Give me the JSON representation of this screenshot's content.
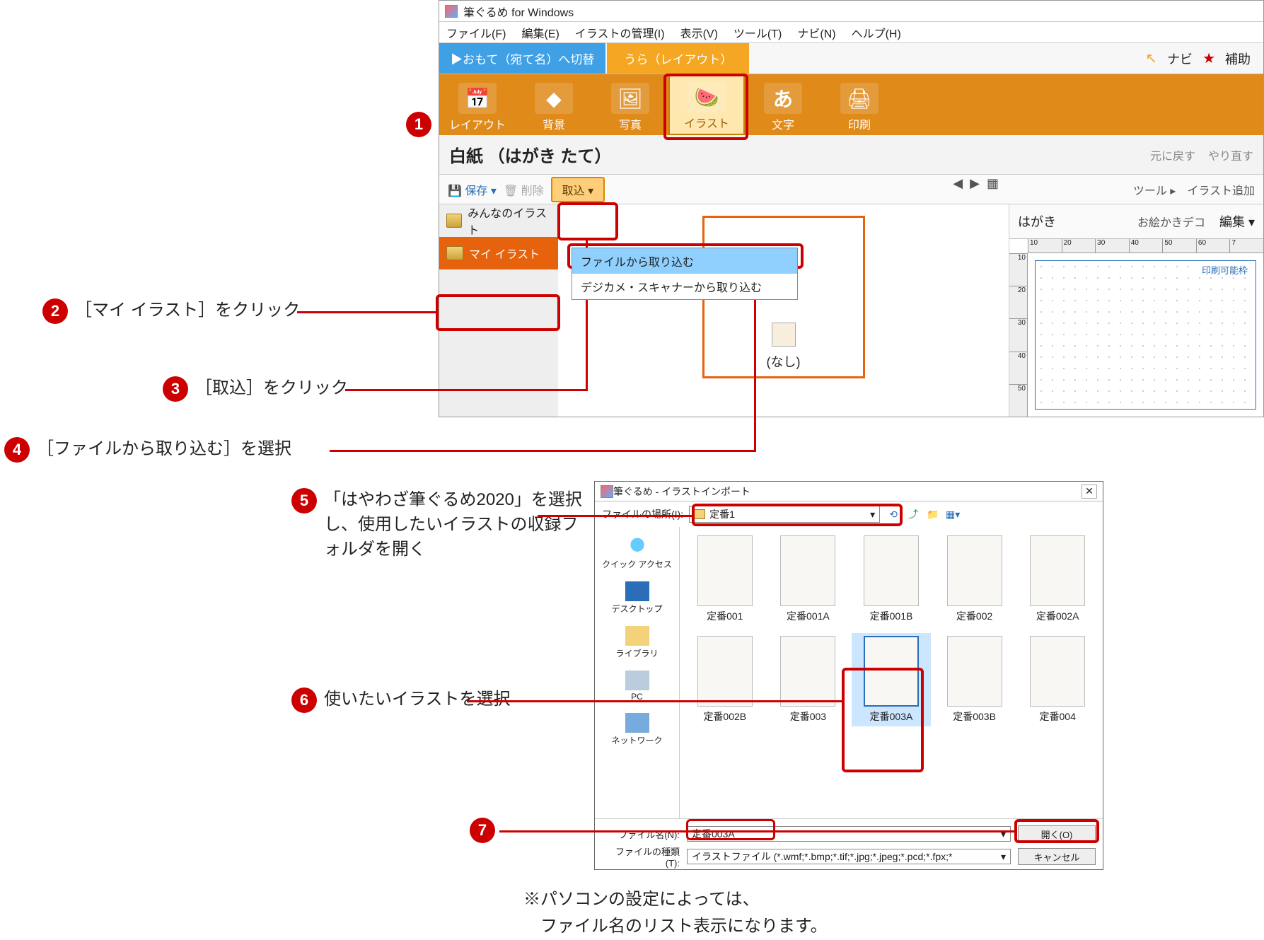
{
  "app": {
    "title": "筆ぐるめ for Windows",
    "menus": [
      "ファイル(F)",
      "編集(E)",
      "イラストの管理(I)",
      "表示(V)",
      "ツール(T)",
      "ナビ(N)",
      "ヘルプ(H)"
    ],
    "tab_blue": "▶おもて（宛て名）へ切替",
    "tab_orange": "うら（レイアウト）",
    "navi": "ナビ",
    "hojo": "補助",
    "ribbon": [
      {
        "label": "レイアウト"
      },
      {
        "label": "背景"
      },
      {
        "label": "写真"
      },
      {
        "label": "イラスト",
        "active": true
      },
      {
        "label": "文字"
      },
      {
        "label": "印刷"
      }
    ],
    "doc_title": "白紙 （はがき たて）",
    "undo": "元に戻す",
    "redo": "やり直す",
    "save": "保存",
    "delete": "削除",
    "import": "取込",
    "tool": "ツール",
    "add_illust": "イラスト追加",
    "side_items": [
      {
        "label": "みんなのイラスト"
      },
      {
        "label": "マイ イラスト",
        "selected": true
      }
    ],
    "dropdown": {
      "file": "ファイルから取り込む",
      "scanner": "デジカメ・スキャナーから取り込む"
    },
    "thumb_none": "(なし)",
    "hagaki": "はがき",
    "oekaki": "お絵かきデコ",
    "edit": "編集",
    "print_frame": "印刷可能枠",
    "ruler_ticks": [
      "10",
      "20",
      "30",
      "40",
      "50",
      "60",
      "7"
    ],
    "ruler_ticks_v": [
      "10",
      "20",
      "30",
      "40",
      "50"
    ]
  },
  "dialog": {
    "title": "筆ぐるめ - イラストインポート",
    "location_label": "ファイルの場所(I):",
    "location_value": "定番1",
    "places": [
      "クイック アクセス",
      "デスクトップ",
      "ライブラリ",
      "PC",
      "ネットワーク"
    ],
    "files_row1": [
      "定番001",
      "定番001A",
      "定番001B",
      "定番002",
      "定番002A"
    ],
    "files_row2": [
      "定番002B",
      "定番003",
      "定番003A",
      "定番003B",
      "定番004"
    ],
    "selected_file": "定番003A",
    "filename_label": "ファイル名(N):",
    "filename_value": "定番003A",
    "filetype_label": "ファイルの種類(T):",
    "filetype_value": "イラストファイル (*.wmf;*.bmp;*.tif;*.jpg;*.jpeg;*.pcd;*.fpx;*",
    "open": "開く(O)",
    "cancel": "キャンセル"
  },
  "steps": {
    "s2": "［マイ イラスト］をクリック",
    "s3": "［取込］をクリック",
    "s4": "［ファイルから取り込む］を選択",
    "s5": "「はやわざ筆ぐるめ2020」を選択し、使用したいイラストの収録フォルダを開く",
    "s6": "使いたいイラストを選択",
    "note1": "※パソコンの設定によっては、",
    "note2": "　ファイル名のリスト表示になります。"
  }
}
